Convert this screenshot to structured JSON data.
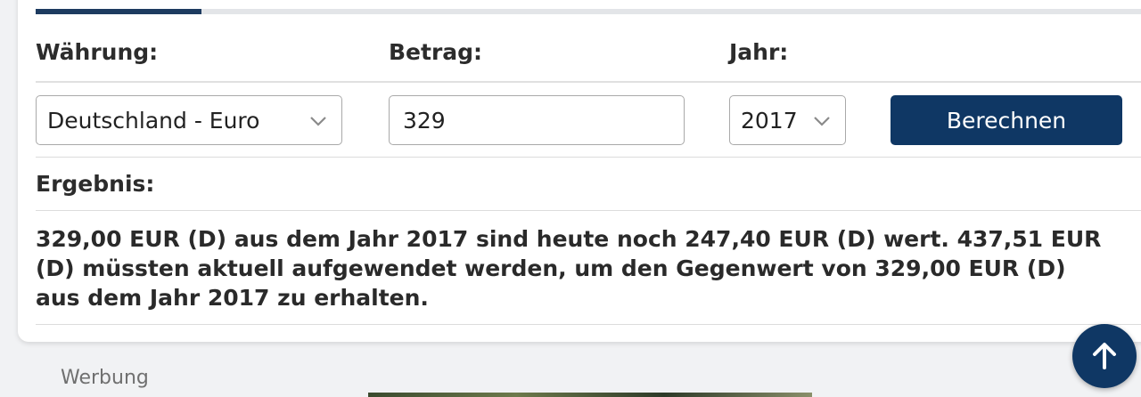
{
  "form": {
    "progress_fraction": 0.15,
    "currency_label": "Währung:",
    "currency_value": "Deutschland - Euro",
    "amount_label": "Betrag:",
    "amount_value": "329",
    "year_label": "Jahr:",
    "year_value": "2017",
    "submit_label": "Berechnen"
  },
  "result": {
    "label": "Ergebnis:",
    "text": "329,00 EUR (D) aus dem Jahr 2017 sind heute noch 247,40 EUR (D) wert. 437,51 EUR (D) müssten aktuell aufgewendet werden, um den Gegenwert von 329,00 EUR (D) aus dem Jahr 2017 zu erhalten."
  },
  "ad": {
    "label": "Werbung"
  },
  "icons": {
    "select_chevron": "chevron-down-icon",
    "scroll_top": "arrow-up-icon"
  },
  "colors": {
    "primary": "#0f3764",
    "progress": "#1d3b60"
  }
}
